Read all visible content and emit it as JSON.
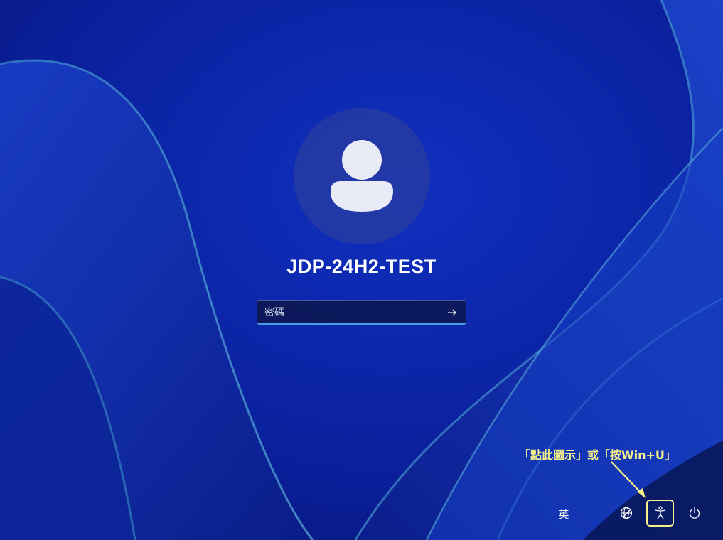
{
  "login": {
    "username": "JDP-24H2-TEST",
    "password_placeholder": "密碼",
    "password_value": ""
  },
  "annotation": {
    "text": "「點此圖示」或「按Win+U」",
    "color": "#f5f08a"
  },
  "taskbar": {
    "language_label": "英",
    "network_icon": "network-globe-icon",
    "accessibility_icon": "accessibility-icon",
    "power_icon": "power-icon"
  },
  "colors": {
    "background": "#0a1a8a",
    "accent_underline": "#4a9fe8",
    "highlight": "#f5f08a"
  }
}
